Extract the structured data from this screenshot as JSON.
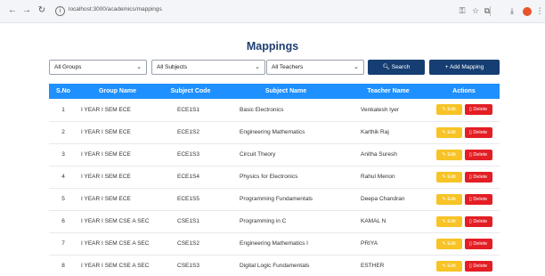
{
  "browser": {
    "url": "localhost:3000/academics/mappings"
  },
  "page": {
    "title": "Mappings"
  },
  "filters": {
    "groups": "All Groups",
    "subjects": "All Subjects",
    "teachers": "All Teachers",
    "search_label": "Search",
    "add_label": "+ Add Mapping"
  },
  "table": {
    "headers": [
      "S.No",
      "Group Name",
      "Subject Code",
      "Subject Name",
      "Teacher Name",
      "Actions"
    ],
    "edit_label": "Edit",
    "delete_label": "Delete",
    "rows": [
      {
        "no": "1",
        "group": "I YEAR I SEM ECE",
        "code": "ECE1S1",
        "subject": "Basic Electronics",
        "teacher": "Venkatesh Iyer"
      },
      {
        "no": "2",
        "group": "I YEAR I SEM ECE",
        "code": "ECE1S2",
        "subject": "Engineering Mathematics",
        "teacher": "Karthik Raj"
      },
      {
        "no": "3",
        "group": "I YEAR I SEM ECE",
        "code": "ECE1S3",
        "subject": "Circuit Theory",
        "teacher": "Anitha Suresh"
      },
      {
        "no": "4",
        "group": "I YEAR I SEM ECE",
        "code": "ECE1S4",
        "subject": "Physics for Electronics",
        "teacher": "Rahul Menon"
      },
      {
        "no": "5",
        "group": "I YEAR I SEM ECE",
        "code": "ECE1S5",
        "subject": "Programming Fundamentals",
        "teacher": "Deepa Chandran"
      },
      {
        "no": "6",
        "group": "I YEAR I SEM CSE A SEC",
        "code": "CSE1S1",
        "subject": "Programming in C",
        "teacher": "KAMAL N"
      },
      {
        "no": "7",
        "group": "I YEAR I SEM CSE A SEC",
        "code": "CSE1S2",
        "subject": "Engineering Mathematics I",
        "teacher": "PRIYA"
      },
      {
        "no": "8",
        "group": "I YEAR I SEM CSE A SEC",
        "code": "CSE1S3",
        "subject": "Digital Logic Fundamentals",
        "teacher": "ESTHER"
      }
    ]
  },
  "colors": {
    "header_bg": "#1e90ff",
    "title": "#1f3e72",
    "primary_button": "#163e72",
    "edit_button": "#f7c325",
    "delete_button": "#e31e24"
  }
}
